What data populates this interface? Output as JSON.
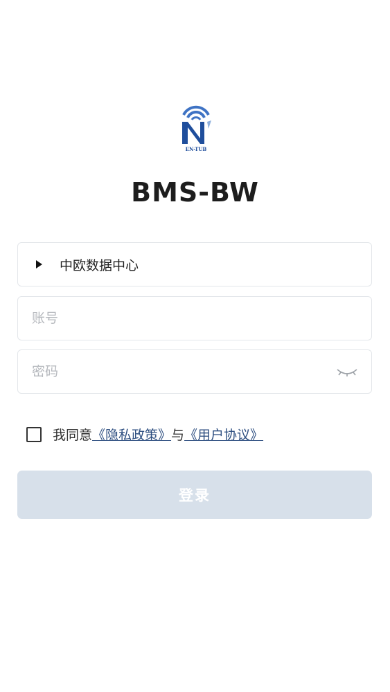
{
  "app": {
    "logo_text": "EN-TUB",
    "title": "BMS-BW"
  },
  "server_select": {
    "value": "中欧数据中心"
  },
  "account": {
    "placeholder": "账号",
    "value": ""
  },
  "password": {
    "placeholder": "密码",
    "value": ""
  },
  "agreement": {
    "prefix": "我同意",
    "privacy_link": "《隐私政策》",
    "connector": "与",
    "terms_link": "《用户协议》",
    "checked": false
  },
  "login": {
    "label": "登录"
  },
  "colors": {
    "link": "#2d4e80",
    "button_disabled": "#d7e0ea",
    "logo_blue": "#1f4e9c"
  },
  "icons": {
    "server_arrow": "caret-right-icon",
    "password_toggle": "eye-closed-icon",
    "logo": "brand-logo"
  }
}
